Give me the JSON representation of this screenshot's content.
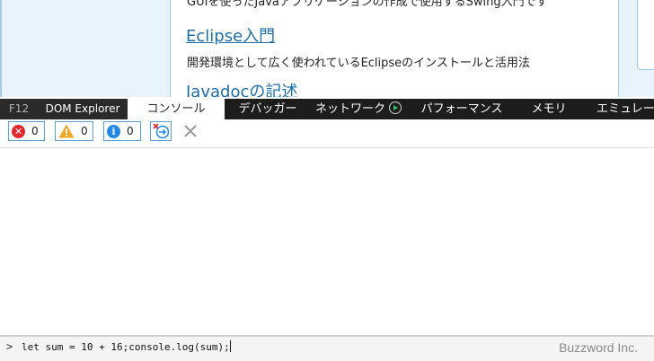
{
  "webpage": {
    "top_desc": "GUIを使ったJavaアプリケーションの作成で使用するSwing入門です",
    "eclipse_link": "Eclipse入門",
    "eclipse_desc": "開発環境として広く使われているEclipseのインストールと活用法",
    "javadoc_link": "Javadocの記述",
    "link_color": "#1e6da8"
  },
  "devtools": {
    "tabs": {
      "f12": "F12",
      "dom": "DOM Explorer",
      "console": "コンソール",
      "debugger": "デバッガー",
      "network": "ネットワーク",
      "performance": "パフォーマンス",
      "memory": "メモリ",
      "emulation": "エミュレーション"
    },
    "active_tab": "console",
    "toolbar": {
      "errors_count": "0",
      "warnings_count": "0",
      "info_count": "0",
      "icons": [
        "error-icon",
        "warning-icon",
        "info-icon",
        "clear-on-navigate-icon",
        "clear-console-icon"
      ]
    },
    "console": {
      "prompt": ">",
      "input_value": "let sum = 10 + 16;console.log(sum);"
    }
  },
  "watermark": "Buzzword Inc.",
  "colors": {
    "tabbar_bg": "#1d1d1d",
    "error": "#e1262c",
    "warning": "#f5a623",
    "info": "#1e88e5",
    "button_border": "#5a9fd6"
  }
}
